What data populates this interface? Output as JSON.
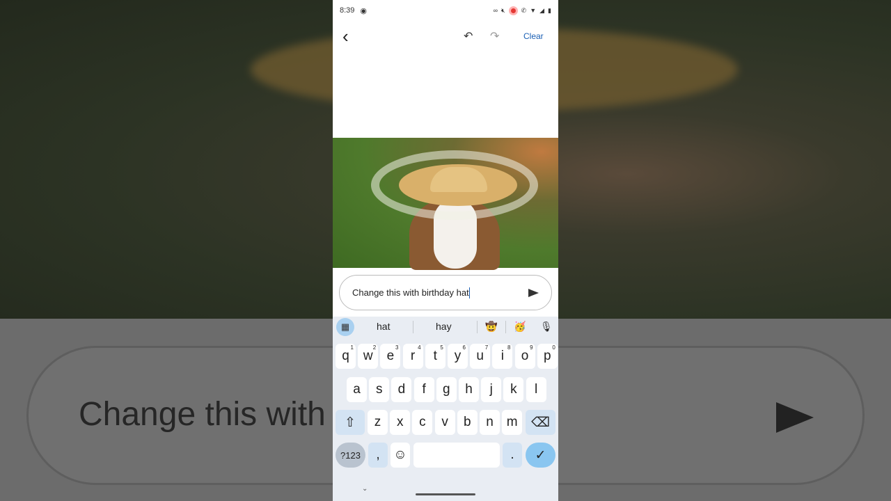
{
  "status": {
    "time": "8:39"
  },
  "toolbar": {
    "back": "‹",
    "undo": "↶",
    "redo": "↷",
    "clear": "Clear"
  },
  "prompt": {
    "value": "Change this with birthday hat"
  },
  "background_text": "Change this with",
  "suggestions": {
    "items": [
      "hat",
      "hay"
    ],
    "emoji": [
      "🤠",
      "🥳"
    ],
    "mic": "🎙"
  },
  "keys": {
    "row1": [
      [
        "q",
        "1"
      ],
      [
        "w",
        "2"
      ],
      [
        "e",
        "3"
      ],
      [
        "r",
        "4"
      ],
      [
        "t",
        "5"
      ],
      [
        "y",
        "6"
      ],
      [
        "u",
        "7"
      ],
      [
        "i",
        "8"
      ],
      [
        "o",
        "9"
      ],
      [
        "p",
        "0"
      ]
    ],
    "row2": [
      "a",
      "s",
      "d",
      "f",
      "g",
      "h",
      "j",
      "k",
      "l"
    ],
    "row3": [
      "z",
      "x",
      "c",
      "v",
      "b",
      "n",
      "m"
    ],
    "symbols": "?123",
    "comma": ",",
    "period": ".",
    "emoji": "☺",
    "shift": "⇧",
    "backspace": "⌫",
    "enter": "✓"
  },
  "colors": {
    "accent": "#1a5fb4",
    "enter_key": "#8ac6f0",
    "keyboard_bg": "#e9edf3"
  }
}
